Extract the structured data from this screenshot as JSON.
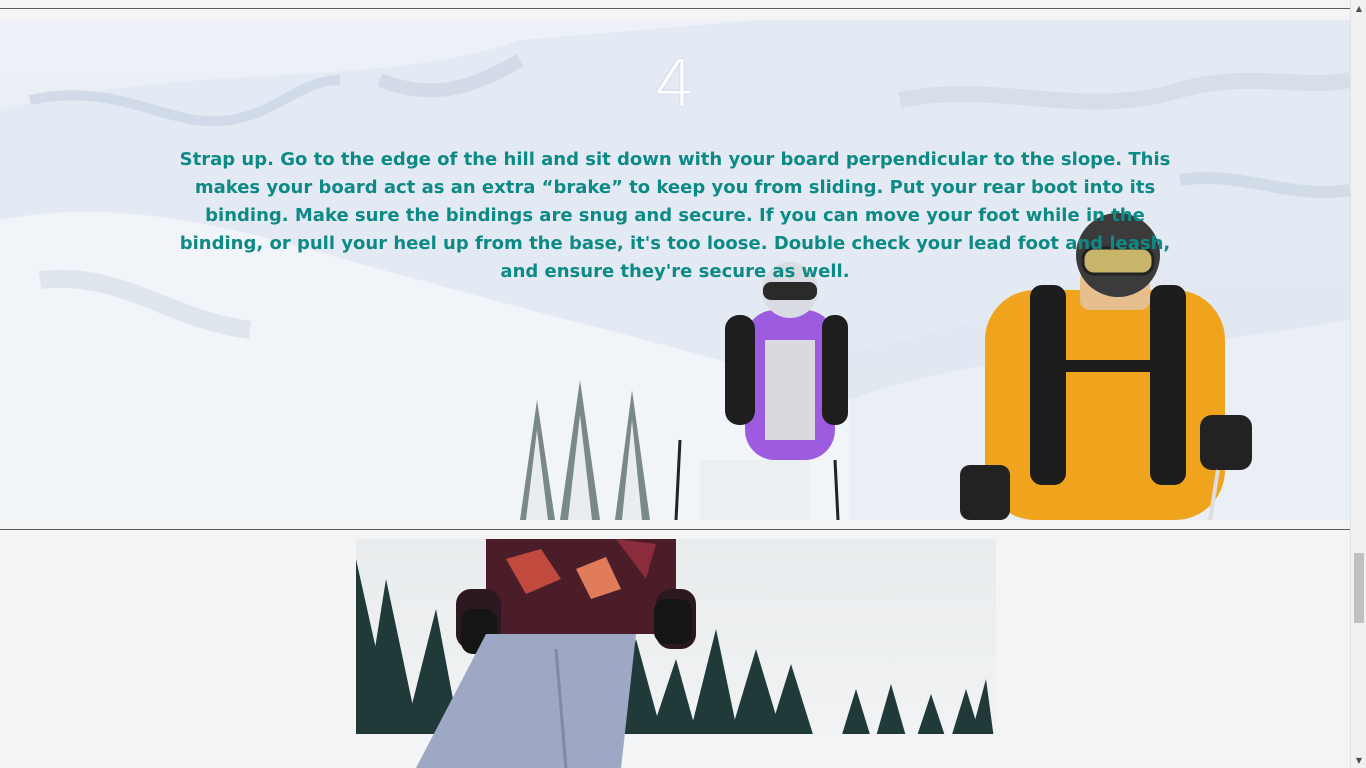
{
  "step": {
    "number": "4",
    "text": "Strap up. Go to the edge of the hill and sit down with your board perpendicular to the slope. This makes your board act as an extra “brake” to keep you from sliding. Put your rear boot into its binding. Make sure the bindings are snug and secure. If you can move your foot while in the binding, or pull your heel up from the base, it's too loose. Double check your lead foot and leash, and ensure they're secure as well."
  },
  "colors": {
    "step_text": "#0e8a86",
    "step_number": "#ffffff",
    "background": "#f4f4f4"
  },
  "scrollbar": {
    "up_icon": "triangle-up",
    "down_icon": "triangle-down"
  }
}
